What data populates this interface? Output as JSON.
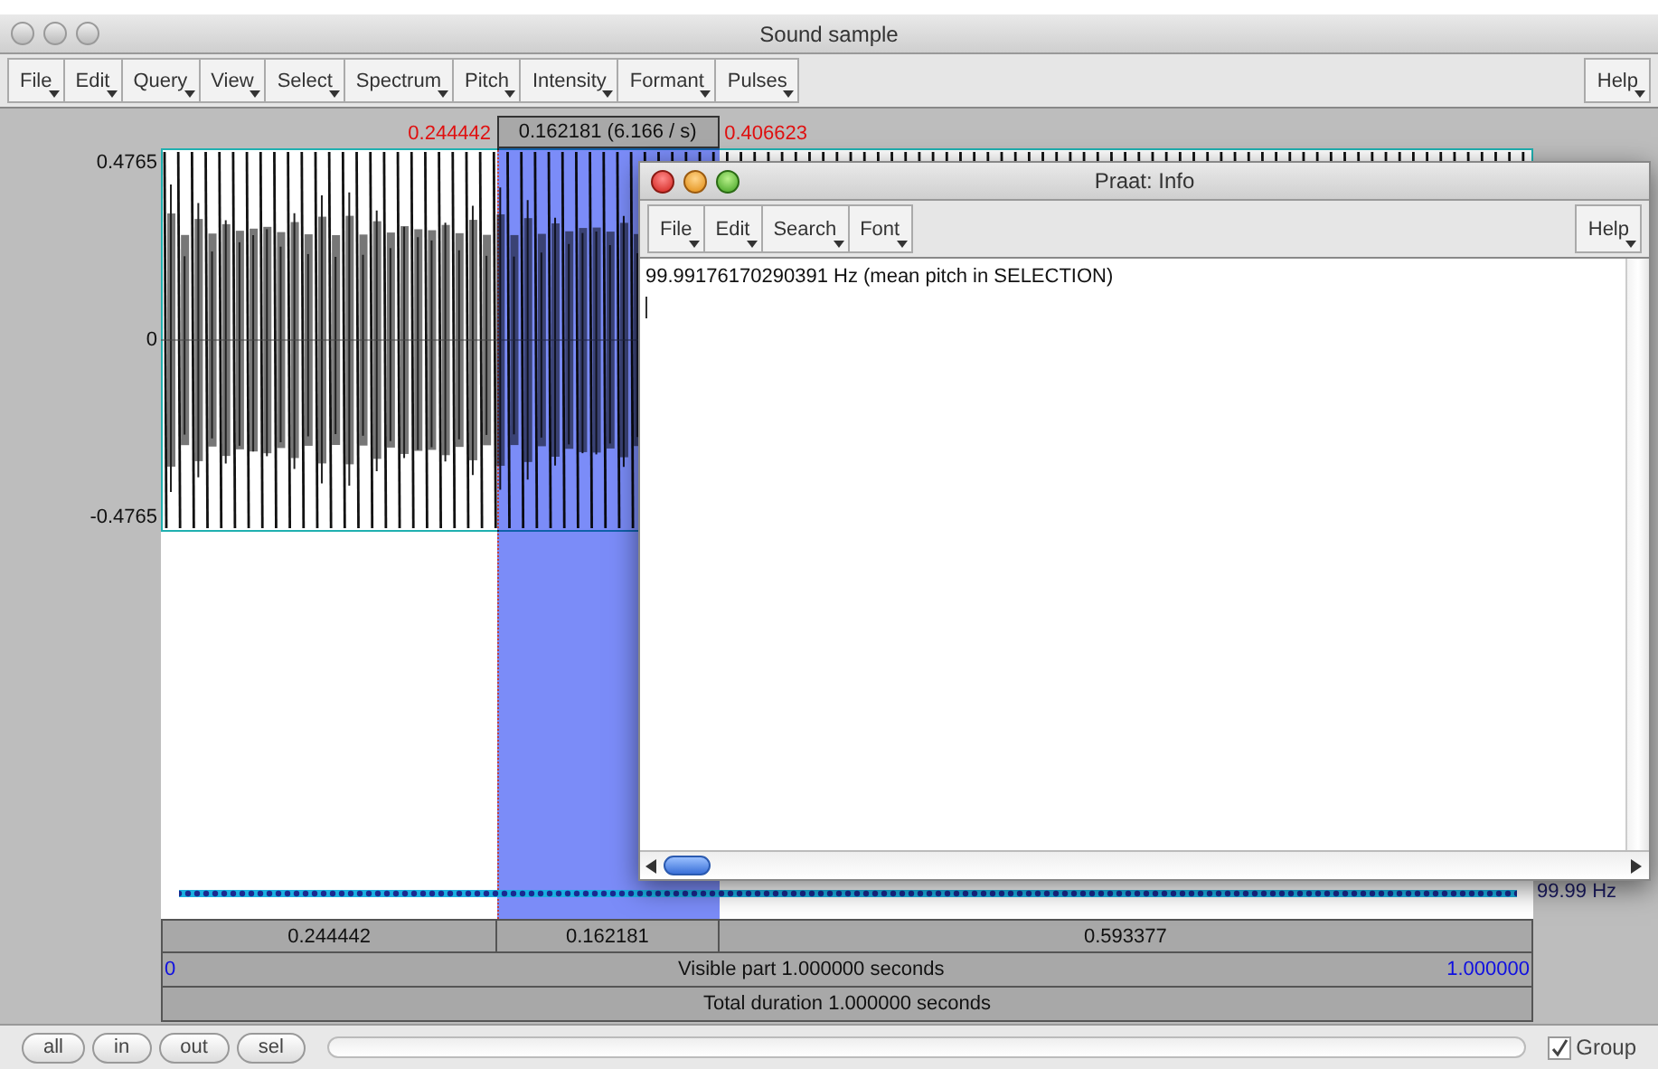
{
  "main_window": {
    "title": "Sound sample",
    "menus": [
      "File",
      "Edit",
      "Query",
      "View",
      "Select",
      "Spectrum",
      "Pitch",
      "Intensity",
      "Formant",
      "Pulses"
    ],
    "help": "Help"
  },
  "editor": {
    "selection_start": "0.244442",
    "selection_length": "0.162181 (6.166 / s)",
    "selection_end": "0.406623",
    "y_max": "0.4765",
    "y_zero": "0",
    "y_min": "-0.4765",
    "pitch_reading": "99.99 Hz",
    "segments": [
      "0.244442",
      "0.162181",
      "0.593377"
    ],
    "visible_start": "0",
    "visible_label": "Visible part 1.000000 seconds",
    "visible_end": "1.000000",
    "total": "Total duration 1.000000 seconds"
  },
  "zoom_buttons": [
    "all",
    "in",
    "out",
    "sel"
  ],
  "group": {
    "label": "Group",
    "checked": true
  },
  "info_window": {
    "title": "Praat: Info",
    "menus": [
      "File",
      "Edit",
      "Search",
      "Font"
    ],
    "help": "Help",
    "text": "99.99176170290391 Hz (mean pitch in SELECTION)"
  }
}
